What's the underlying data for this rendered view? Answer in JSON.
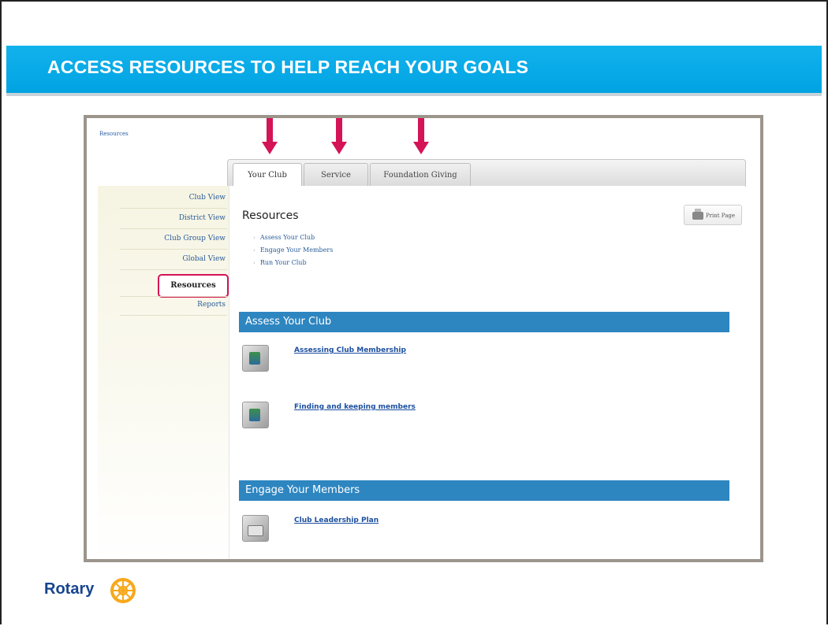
{
  "slide": {
    "title": "ACCESS RESOURCES TO HELP REACH YOUR GOALS",
    "colors": {
      "banner": "#00a3e2",
      "arrow": "#d41456",
      "section_bar": "#2e86c1"
    }
  },
  "screenshot": {
    "breadcrumb": "Resources",
    "tabs": [
      "Your Club",
      "Service",
      "Foundation Giving"
    ],
    "active_tab": "Your Club",
    "sidebar": {
      "items": [
        "Club View",
        "District View",
        "Club Group View",
        "Global View",
        "Resources",
        "Reports"
      ],
      "active": "Resources"
    },
    "print_label": "Print Page",
    "resources_heading": "Resources",
    "links": [
      "Assess Your Club",
      "Engage Your Members",
      "Run Your Club"
    ],
    "sections": [
      {
        "title": "Assess Your Club",
        "items": [
          "Assessing Club Membership",
          "Finding and keeping members"
        ]
      },
      {
        "title": "Engage Your Members",
        "items": [
          "Club Leadership Plan"
        ]
      }
    ]
  },
  "footer": {
    "brand": "Rotary",
    "logo_icon": "rotary-wheel-icon"
  }
}
